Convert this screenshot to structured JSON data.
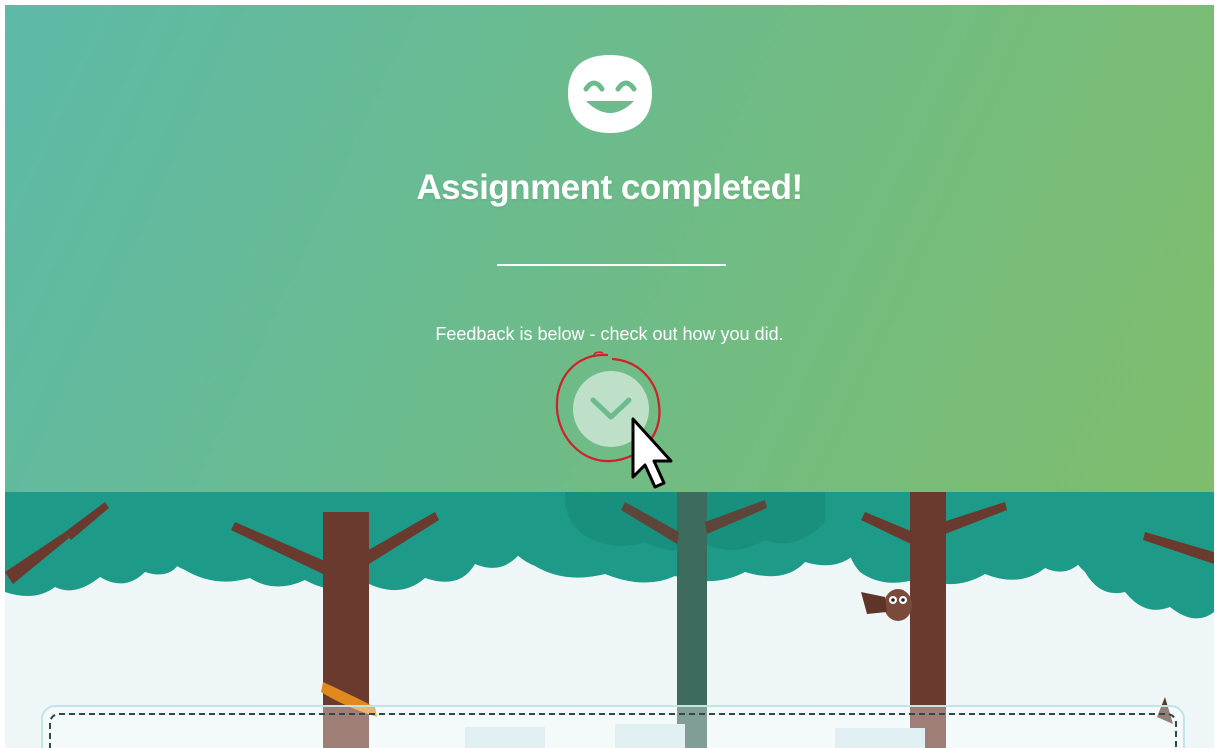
{
  "completion": {
    "title": "Assignment completed!",
    "message": "Feedback is below - check out how you did.",
    "icon": "smiley-face-icon",
    "scroll_icon": "chevron-down-icon"
  },
  "colors": {
    "hero_gradient_start": "#5dbaa8",
    "hero_gradient_end": "#7fbd6c",
    "tree_foliage": "#1e9a88",
    "tree_trunk": "#6a3a2e",
    "click_indicator": "#d0202a",
    "text": "#ffffff"
  }
}
